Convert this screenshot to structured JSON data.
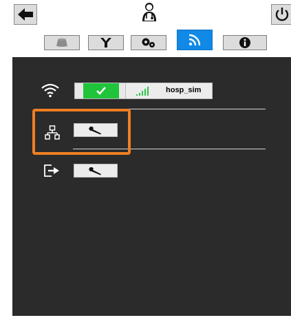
{
  "header": {
    "back_icon": "arrow-left-icon",
    "user_icon": "doctor-user-icon",
    "power_icon": "power-icon"
  },
  "tabs": [
    {
      "icon": "bed-icon",
      "active": false
    },
    {
      "icon": "y-connector-icon",
      "active": false
    },
    {
      "icon": "gears-icon",
      "active": false
    },
    {
      "icon": "wifi-icon",
      "active": true
    },
    {
      "icon": "info-icon",
      "active": false
    }
  ],
  "network": {
    "wifi": {
      "icon": "wifi-icon",
      "status_icon": "checkmark-icon",
      "signal_icon": "signal-bars-icon",
      "ssid": "hosp_sim"
    },
    "ethernet": {
      "icon": "network-tree-icon",
      "button_icon": "wrench-icon"
    },
    "export": {
      "icon": "export-icon",
      "button_icon": "wrench-icon"
    }
  },
  "colors": {
    "active_tab": "#1189e6",
    "panel": "#2b2b2b",
    "status_ok": "#1fc43a",
    "highlight": "#ef7f22"
  }
}
